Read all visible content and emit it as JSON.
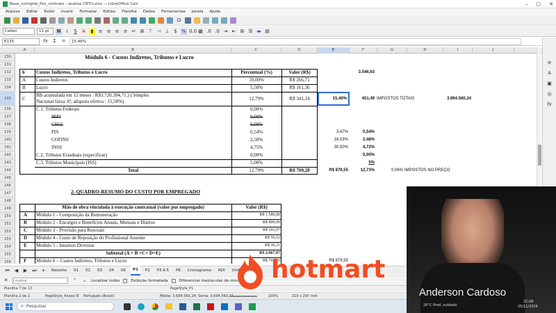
{
  "window": {
    "title": "Base_corrigida_Pos_contrato - analise CBTU.xlsx — LibreOffice Calc"
  },
  "menu": [
    "Arquivo",
    "Editar",
    "Exibir",
    "Inserir",
    "Formatar",
    "Estilos",
    "Planilha",
    "Dados",
    "Ferramentas",
    "Janela",
    "Ajuda"
  ],
  "font": {
    "name": "Calibri",
    "size": "11 pt"
  },
  "formula": {
    "cell_ref": "E135",
    "value": "15,46%"
  },
  "columns": [
    "A",
    "B",
    "C",
    "D",
    "E",
    "F",
    "G",
    "H",
    "I",
    "J"
  ],
  "rows": [
    "130",
    "131",
    "132",
    "133",
    "134",
    "135",
    "136",
    "137",
    "138",
    "139",
    "140",
    "141",
    "142",
    "143",
    "144",
    "145",
    "146",
    "147",
    "148",
    "149",
    "150",
    "151",
    "152",
    "153",
    "154",
    "155",
    "156"
  ],
  "sheet": {
    "modulo6_title": "Módulo 6 - Custos Indiretos, Tributos e Lucro",
    "hdr_num": "6",
    "hdr_desc": "Custos Indiretos, Tributos e Lucro",
    "hdr_pct": "Percentual (%)",
    "hdr_val": "Valor (R$)",
    "hdr_f": "3.546,63",
    "rA": {
      "a": "A",
      "b": "Custos Indiretos",
      "c": "10,00%",
      "d": "R$ 266,71"
    },
    "rB": {
      "a": "B",
      "b": "Lucro",
      "c": "5,50%",
      "d": "R$ 161,36"
    },
    "rC": {
      "a": "C",
      "b1": "RB acumulada em 12 meses : R$3.720.394,71.) ( Simples",
      "b2": "Nacional faixa: 6ª, alíquota efetiva : 15,58%)",
      "c": "12,79%",
      "d": "R$ 341,14",
      "e": "15,46%",
      "f": "451,49",
      "g": "IMPOSTOS TOTAIS",
      "i": "3.694.560,24"
    },
    "rC1": {
      "b": "C.1. Tributos Federais",
      "c": "0,00%"
    },
    "rIRPJ": {
      "b": "IRPJ",
      "c": "0,00%"
    },
    "rCSLL": {
      "b": "CSLL",
      "c": "0,00%"
    },
    "rPIS": {
      "b": "PIS",
      "c": "0,54%",
      "e": "3,47%",
      "f": "0,54%"
    },
    "rCOF": {
      "b": "COFINS",
      "c": "2,50%",
      "e": "16,03%",
      "f": "2,48%"
    },
    "rINSS": {
      "b": "INSS",
      "c": "4,75%",
      "e": "30,50%",
      "f": "4,72%"
    },
    "rC2": {
      "b": "C.2. Tributos Estaduais (especificar)",
      "c": "0,00%",
      "f": "0,00%"
    },
    "rC3": {
      "b": "C.3. Tributos Municipais (ISS)",
      "c": "5,00%",
      "f": "5%"
    },
    "rTot": {
      "b": "Total",
      "c": "12,79%",
      "d": "R$ 769,20",
      "e": "R$ 879,55",
      "f": "12,73%",
      "g": "0,06%",
      "h": "IMPOSTOS NO PREÇO"
    },
    "quadro_title": "2. QUADRO-RESUMO DO CUSTO POR EMPREGADO",
    "q_hdr": {
      "b": "Mão de obra vinculada à execução contratual (valor por empregado)",
      "c": "Valor (R$)"
    },
    "q": [
      {
        "a": "A",
        "b": "Módulo 1 - Composição da Remuneração",
        "c": "R$ 1.580,08"
      },
      {
        "a": "B",
        "b": "Módulo 2 - Encargos e Benefícios Anuais, Mensais e Diários",
        "c": "R$ 899,09"
      },
      {
        "a": "C",
        "b": "Módulo 3 - Provisão para Rescisão",
        "c": "R$ 101,07"
      },
      {
        "a": "D",
        "b": "Módulo 4 - Custo de Reposição do Profissional Ausente",
        "c": "R$ 56,52"
      },
      {
        "a": "E",
        "b": "Módulo 5 - Insumos Diversos",
        "c": "R$ 36,31"
      }
    ],
    "subtotal": {
      "b": "Subtotal (A + B +C+ D+E)",
      "c": "R$ 2.667,07"
    },
    "rF": {
      "a": "F",
      "b": "Módulo 6 – Custos Indiretos, Tributos e Lucro",
      "c": "R$ 769,20",
      "e": "R$ 879,55"
    }
  },
  "tabs": [
    "Resumo",
    "01",
    "02",
    "03",
    "04",
    "05",
    "P1",
    "P2",
    "P3.4.5",
    "P6",
    "Cronograma",
    "RDI",
    "Uniformes"
  ],
  "active_tab": "P1",
  "findbar": {
    "placeholder": "Localizar",
    "find_all": "Localizar todos",
    "formatted": "Exibição formatada",
    "match_case": "Diferenciar maiúsculas de minúsculas"
  },
  "status": {
    "sheet": "Planilha 7 de 13",
    "pagestyle": "PageStyle_P1",
    "sheet2": "Planilha 2 de 2",
    "pagestyle2": "PageStyle_Anexo III",
    "lang": "Português (Brasil)",
    "stats": "Média: 3.694.560,24; Soma: 3.694.560,24",
    "zoom": "100%",
    "size": "210 x 297 mm"
  },
  "taskbar": {
    "search": "Pesquisar",
    "weather": "26°C Pred. nublado",
    "time": "22:08",
    "date": "25/11/2024"
  },
  "overlay": {
    "brand": "hotmart",
    "presenter": "Anderson Cardoso",
    "brand_color": "#f04e23"
  }
}
